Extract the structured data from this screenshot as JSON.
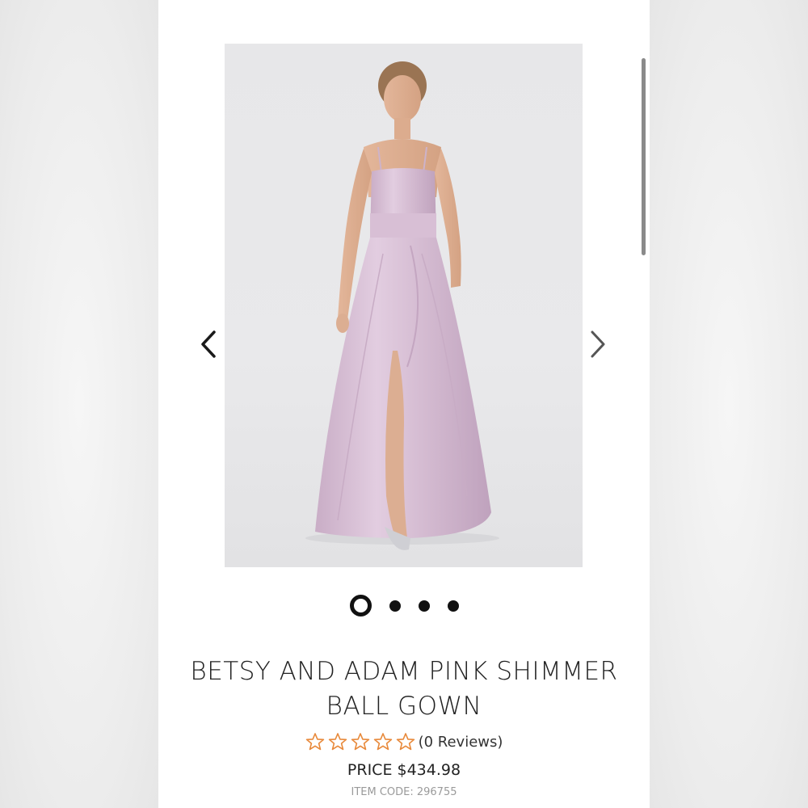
{
  "product": {
    "title_line1": "BETSY AND ADAM PINK SHIMMER",
    "title_line2": "BALL GOWN",
    "rating": 0,
    "rating_max": 5,
    "reviews_label": "(0 Reviews)",
    "price_label": "PRICE $434.98",
    "item_code_label": "ITEM CODE: 296755"
  },
  "carousel": {
    "slide_count": 4,
    "active_index": 0,
    "image_alt": "Model wearing pink shimmer ball gown",
    "prev_icon": "chevron-left-icon",
    "next_icon": "chevron-right-icon"
  },
  "colors": {
    "star_outline": "#e8893a",
    "gown": "#d9bfd4",
    "dot": "#111111"
  }
}
